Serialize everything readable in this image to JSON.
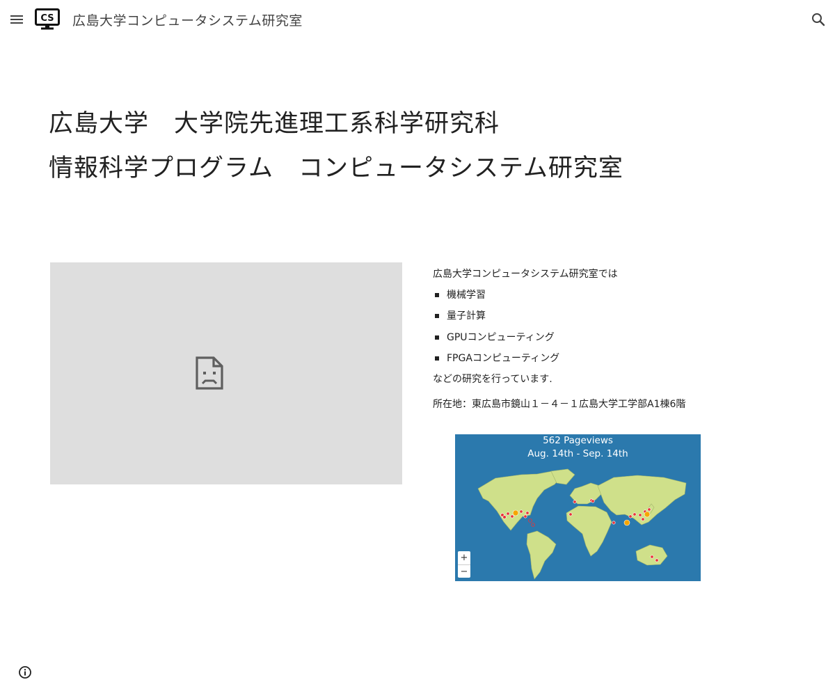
{
  "header": {
    "menu_icon": "hamburger-menu-icon",
    "logo_text": "CS",
    "site_title": "広島大学コンピュータシステム研究室",
    "search_icon": "search-icon"
  },
  "main": {
    "heading_line1": "広島大学　大学院先進理工系科学研究科",
    "heading_line2": "情報科学プログラム　コンピュータシステム研究室",
    "embed_icon": "broken-document-icon",
    "intro": "広島大学コンピュータシステム研究室では",
    "topics": [
      "機械学習",
      "量子計算",
      "GPUコンピューティング",
      "FPGAコンピューティング"
    ],
    "outro": "などの研究を行っています.",
    "address": "所在地：東広島市鏡山１－４－１広島大学工学部A1棟6階"
  },
  "map_widget": {
    "title_line1": "562 Pageviews",
    "title_line2": "Aug. 14th - Sep. 14th",
    "zoom_in": "+",
    "zoom_out": "−",
    "colors": {
      "ocean": "#2b79ad",
      "land": "#cfe08a",
      "marker": "#e8343a",
      "hotspot": "#f5a500"
    }
  },
  "footer": {
    "info_icon": "info-icon"
  }
}
